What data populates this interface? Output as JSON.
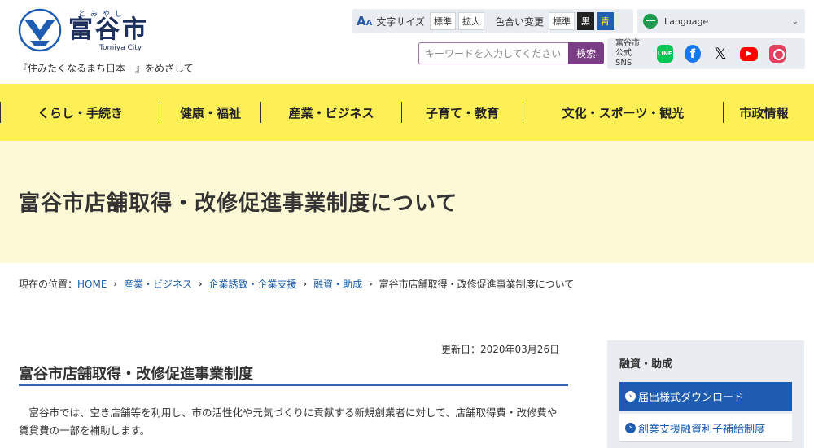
{
  "header": {
    "logo_ruby": "とみやし",
    "logo_name": "富谷市",
    "logo_en": "Tomiya City",
    "tagline": "『住みたくなるまち日本一』をめざして",
    "font_size_icon": "A",
    "font_size_icon_small": "A",
    "font_size_label": "文字サイズ",
    "font_standard": "標準",
    "font_large": "拡大",
    "color_label": "色合い変更",
    "color_standard": "標準",
    "color_black": "黒",
    "color_blue": "青",
    "language_label": "Language",
    "search_placeholder": "キーワードを入力してください",
    "search_button": "検索",
    "sns_label_1": "富谷市",
    "sns_label_2": "公式SNS",
    "sns_line": "LINE",
    "sns_facebook": "f",
    "sns_x": "𝕏",
    "sns_youtube": "▶",
    "sns_icons": [
      "line-icon",
      "facebook-icon",
      "x-icon",
      "youtube-icon",
      "instagram-icon"
    ]
  },
  "nav": {
    "items": [
      "くらし・手続き",
      "健康・福祉",
      "産業・ビジネス",
      "子育て・教育",
      "文化・スポーツ・観光",
      "市政情報"
    ]
  },
  "page": {
    "title": "富谷市店舗取得・改修促進事業制度について",
    "updated": "更新日：2020年03月26日",
    "heading": "富谷市店舗取得・改修促進事業制度",
    "body": "富谷市では、空き店舗等を利用し、市の活性化や元気づくりに貢献する新規創業者に対して、店舗取得費・改修費や賃貸費の一部を補助します。"
  },
  "breadcrumb": {
    "prefix": "現在の位置：",
    "items": [
      "HOME",
      "産業・ビジネス",
      "企業誘致・企業支援",
      "融資・助成"
    ],
    "current": "富谷市店舗取得・改修促進事業制度について",
    "separator": "›"
  },
  "side": {
    "title": "融資・助成",
    "items": [
      "届出様式ダウンロード",
      "創業支援融資利子補給制度"
    ],
    "bullet": "›"
  },
  "colors": {
    "nav_bg": "#fdf056",
    "title_bg": "#fdf8d6",
    "accent_blue": "#1d5cb0",
    "search_purple": "#7b3d85"
  }
}
